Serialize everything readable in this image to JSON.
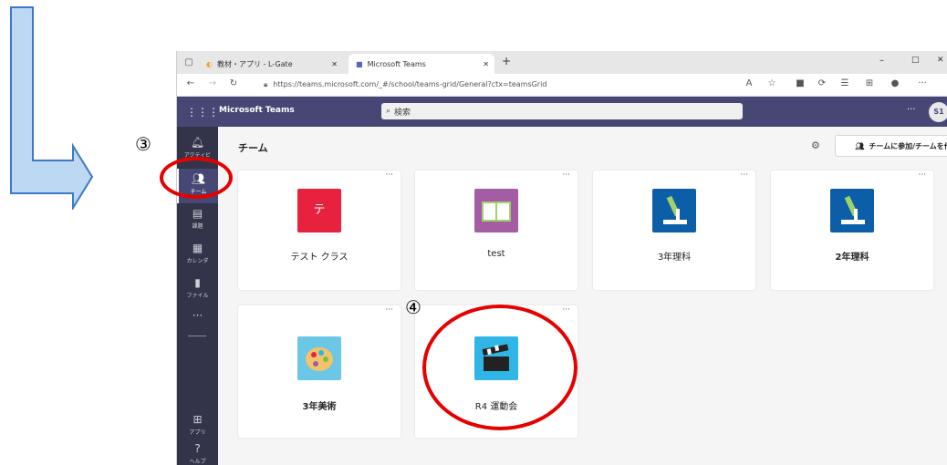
{
  "browser": {
    "tabs": [
      {
        "label": "教材・アプリ - L-Gate"
      },
      {
        "label": "Microsoft Teams"
      }
    ],
    "new_tab": "+",
    "url": "https://teams.microsoft.com/_#/school/teams-grid/General?ctx=teamsGrid"
  },
  "teams": {
    "app_name": "Microsoft Teams",
    "search_placeholder": "検索",
    "more": "···",
    "avatar": "S1"
  },
  "rail": {
    "items": [
      {
        "label": "アクティビ"
      },
      {
        "label": "チーム"
      },
      {
        "label": "課題"
      },
      {
        "label": "カレンダ"
      },
      {
        "label": "ファイル"
      },
      {
        "label": "···"
      },
      {
        "label": "アプリ"
      },
      {
        "label": "ヘルプ"
      }
    ]
  },
  "main": {
    "title": "チーム",
    "join_button": "チームに参加/チームを作成",
    "cards": [
      {
        "name": "テスト クラス",
        "icon_text": "テ",
        "icon": "letter-tile-icon",
        "color": "#e8213e",
        "bold": false
      },
      {
        "name": "test",
        "icon": "book-icon",
        "color": "#a45ca5",
        "bold": false
      },
      {
        "name": "3年理科",
        "icon": "microscope-icon",
        "color": "#0d5ea8",
        "bold": false
      },
      {
        "name": "2年理科",
        "icon": "microscope-icon",
        "color": "#0d5ea8",
        "bold": true
      },
      {
        "name": "3年美術",
        "icon": "palette-icon",
        "color": "#6cc6e6",
        "bold": true
      },
      {
        "name": "R4 運動会",
        "icon": "clapperboard-icon",
        "color": "#2fb6e6",
        "bold": false
      }
    ],
    "card_menu": "···"
  },
  "annotations": {
    "step3": "③",
    "step4": "④"
  }
}
